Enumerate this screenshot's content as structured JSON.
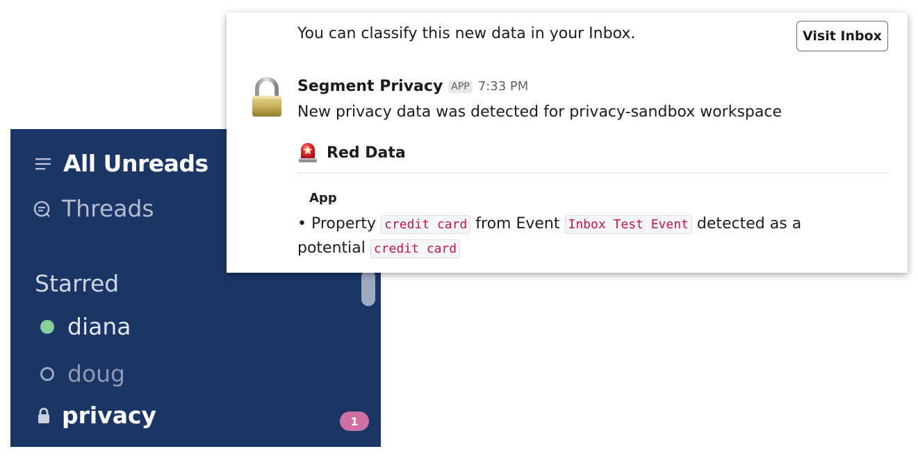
{
  "sidebar": {
    "all_unreads": "All Unreads",
    "threads": "Threads",
    "starred_heading": "Starred",
    "channels": [
      {
        "label": "diana",
        "status": "online"
      },
      {
        "label": "doug",
        "status": "away"
      },
      {
        "label": "privacy",
        "status": "private",
        "unread_count": "1"
      }
    ]
  },
  "message_card": {
    "classify_text": "You can classify this new data in your Inbox.",
    "visit_button": "Visit Inbox",
    "sender": "Segment Privacy",
    "app_tag": "APP",
    "timestamp": "7:33 PM",
    "body": "New privacy data was detected for privacy-sandbox workspace",
    "section_title": "Red Data",
    "field_label": "App",
    "detail": {
      "bullet_prefix": "• Property",
      "property_code": "credit card",
      "from_event_text": "from Event",
      "event_code": "Inbox Test Event",
      "detected_text": "detected as a",
      "potential_text": "potential",
      "classification_code": "credit card"
    }
  },
  "colors": {
    "sidebar_bg": "#1b3666",
    "online_dot": "#8ad09a",
    "badge": "#cf6fa4",
    "code_text": "#c4134f"
  },
  "icons": [
    "menu-lines-icon",
    "threads-icon",
    "lock-icon",
    "padlock-avatar-icon",
    "siren-icon"
  ]
}
